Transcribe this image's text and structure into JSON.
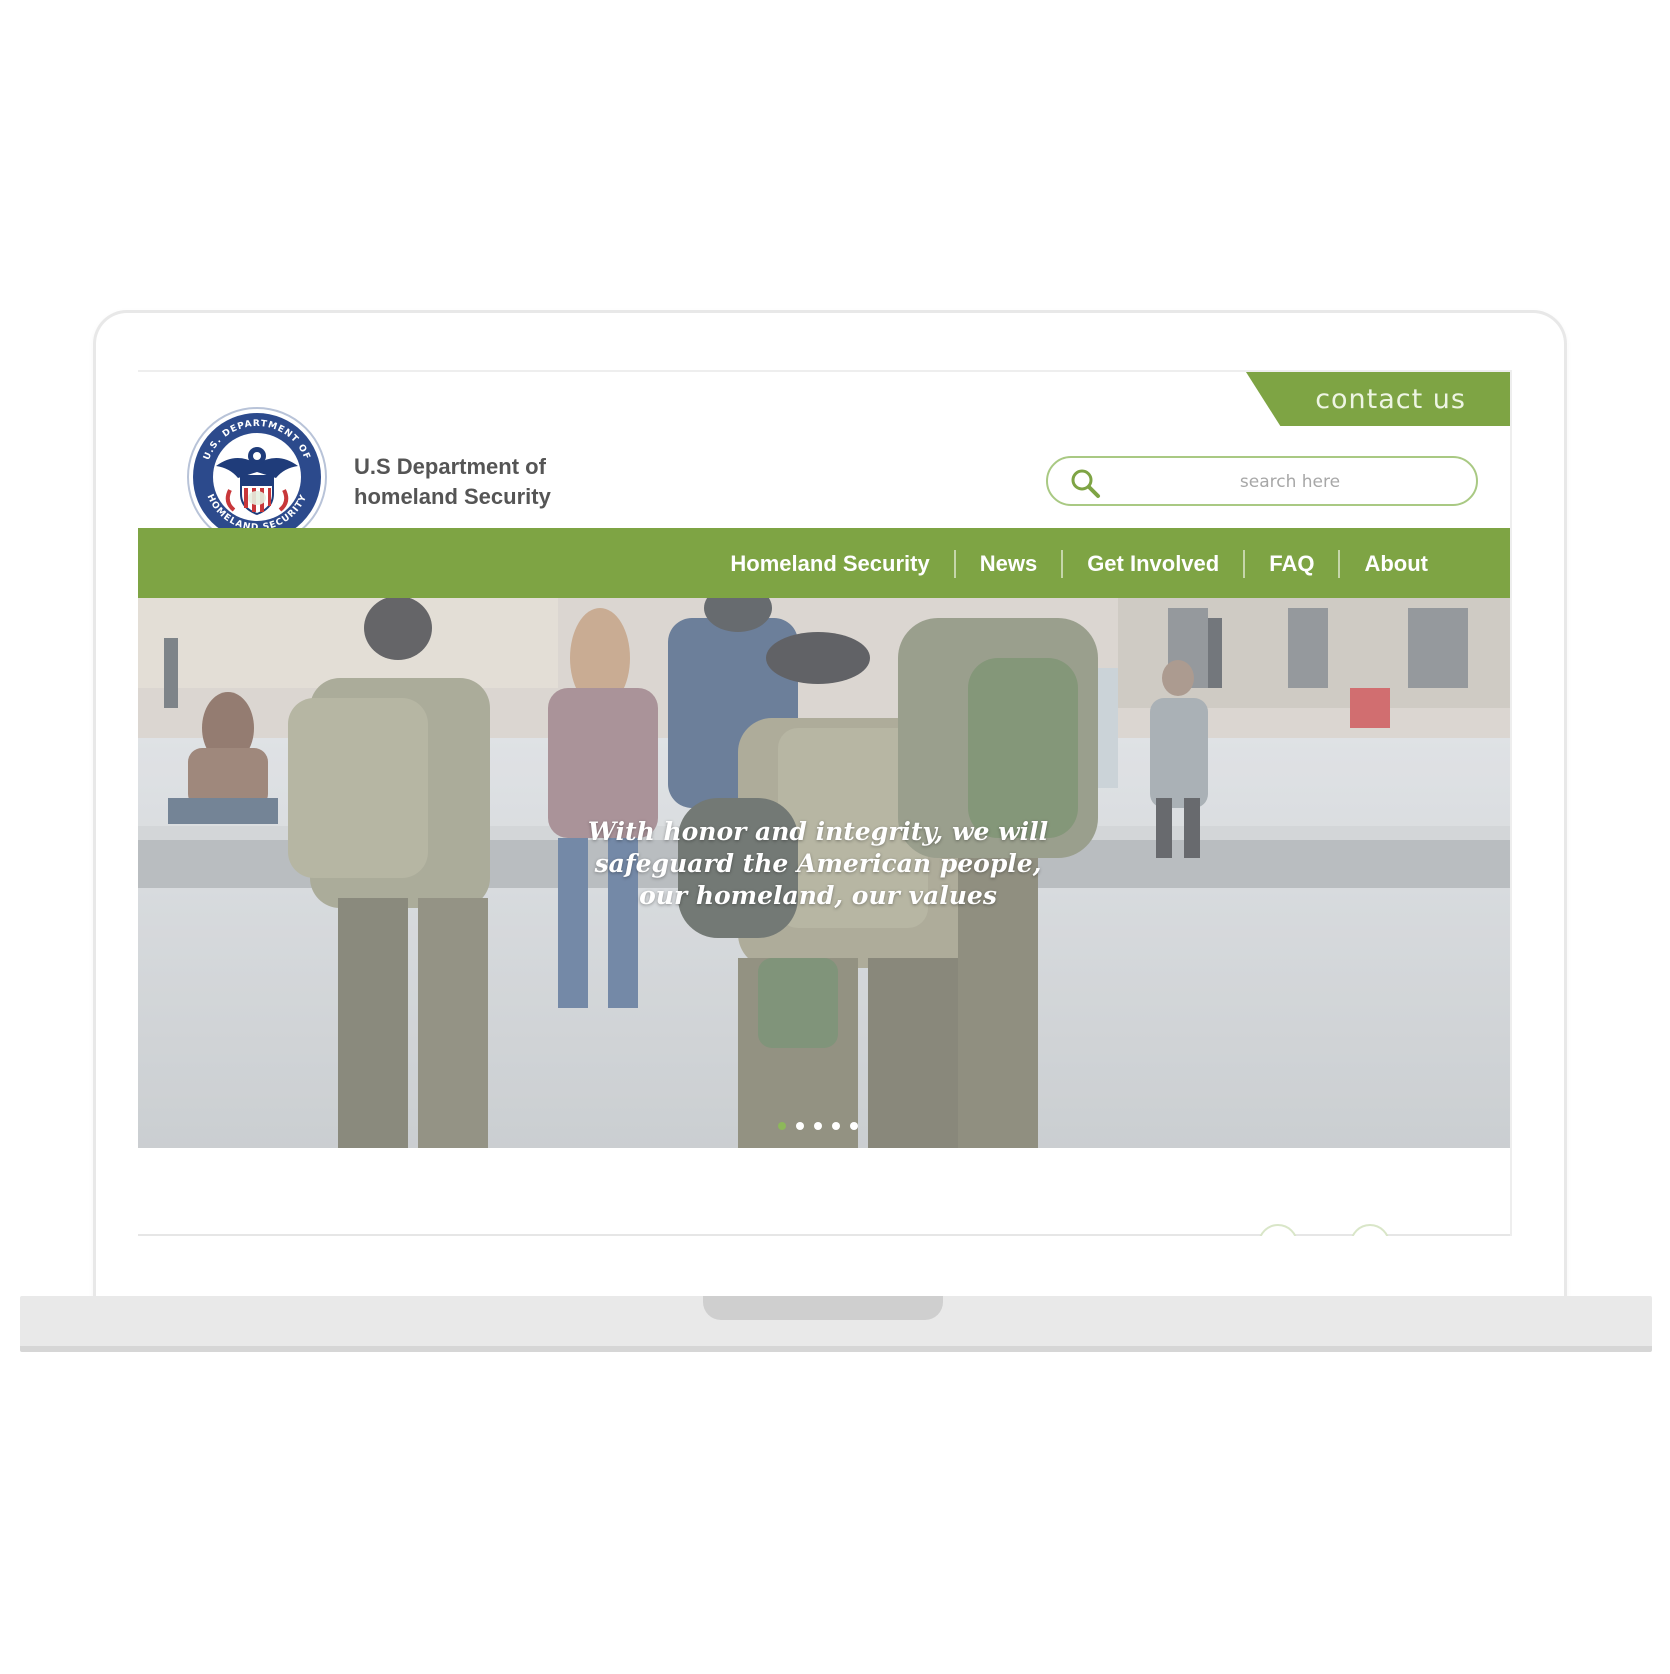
{
  "header": {
    "contact_label": "contact us",
    "org_line1": "U.S Department of",
    "org_line2": "homeland Security",
    "seal_text_top": "U.S. DEPARTMENT OF",
    "seal_text_bottom": "HOMELAND SECURITY"
  },
  "search": {
    "placeholder": "search here",
    "icon": "search-icon"
  },
  "nav": {
    "items": [
      {
        "label": "Homeland Security"
      },
      {
        "label": "News"
      },
      {
        "label": "Get Involved"
      },
      {
        "label": "FAQ"
      },
      {
        "label": "About"
      }
    ]
  },
  "hero": {
    "tagline_line1": "With honor and integrity, we will",
    "tagline_line2": "safeguard the American people,",
    "tagline_line3": "our homeland, our values",
    "slides": 5,
    "active_slide": 1
  },
  "colors": {
    "brand_green": "#7ea444",
    "search_border": "#a9c983",
    "seal_blue": "#1f3c7a",
    "seal_red": "#c8373a"
  }
}
